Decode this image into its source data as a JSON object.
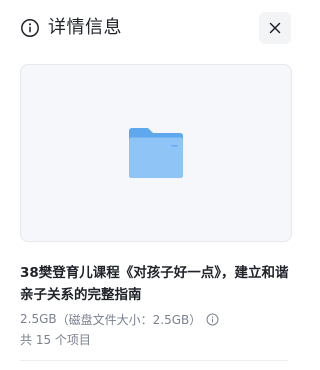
{
  "header": {
    "title": "详情信息",
    "info_icon": "info-circle-icon",
    "close_icon": "close-icon"
  },
  "preview": {
    "icon": "folder-icon",
    "colors": {
      "folder_back": "#5fa8ee",
      "folder_front": "#8ec5f6",
      "background": "#f5f7fa"
    }
  },
  "file": {
    "name": "38樊登育儿课程《对孩子好一点》，建立和谐亲子关系的完整指南",
    "size": "2.5GB",
    "disk_size": "（磁盘文件大小：2.5GB）",
    "size_info_icon": "info-circle-icon",
    "item_count": "共 15 个项目"
  }
}
